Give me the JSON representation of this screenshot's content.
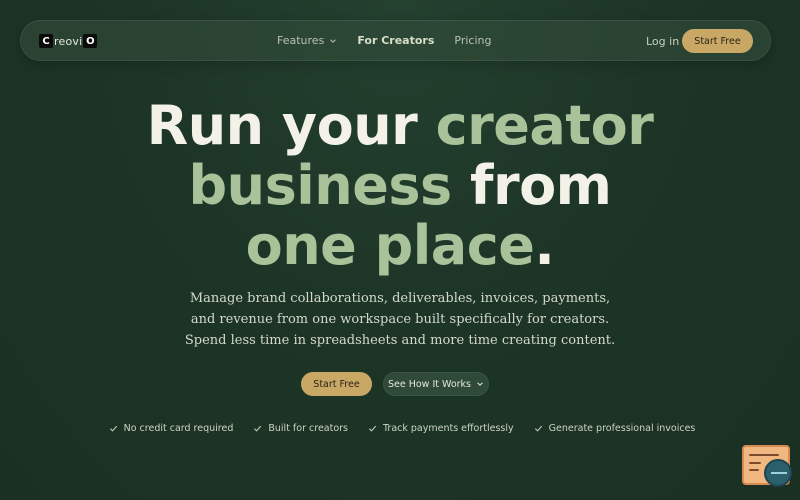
{
  "nav": {
    "logo": {
      "left": "C",
      "middle": "reovi",
      "right": "O"
    },
    "links": [
      {
        "label": "Features",
        "has_dropdown": true
      },
      {
        "label": "For Creators",
        "active": true
      },
      {
        "label": "Pricing"
      }
    ],
    "login_label": "Log in",
    "start_label": "Start Free"
  },
  "hero": {
    "title": {
      "line1_a": "Run your",
      "line1_b": "creator",
      "line2_a": "business",
      "line2_b": "from",
      "line3_a": "one place",
      "line3_b": "."
    },
    "subtitle": "Manage brand collaborations, deliverables, invoices, payments, and revenue from one workspace built specifically for creators. Spend less time in spreadsheets and more time creating content.",
    "cta_primary": "Start Free",
    "cta_secondary": "See How It Works"
  },
  "features": [
    "No credit card required",
    "Built for creators",
    "Track payments effortlessly",
    "Generate professional invoices"
  ],
  "colors": {
    "background": "#1d3527",
    "accent_gold": "#c9a765",
    "headline_green": "#a9c29a",
    "headline_white": "#f4f1e8"
  },
  "icons": {
    "dropdown": "chevron-down-icon",
    "check": "check-icon",
    "widget": "support-widget-icon"
  }
}
